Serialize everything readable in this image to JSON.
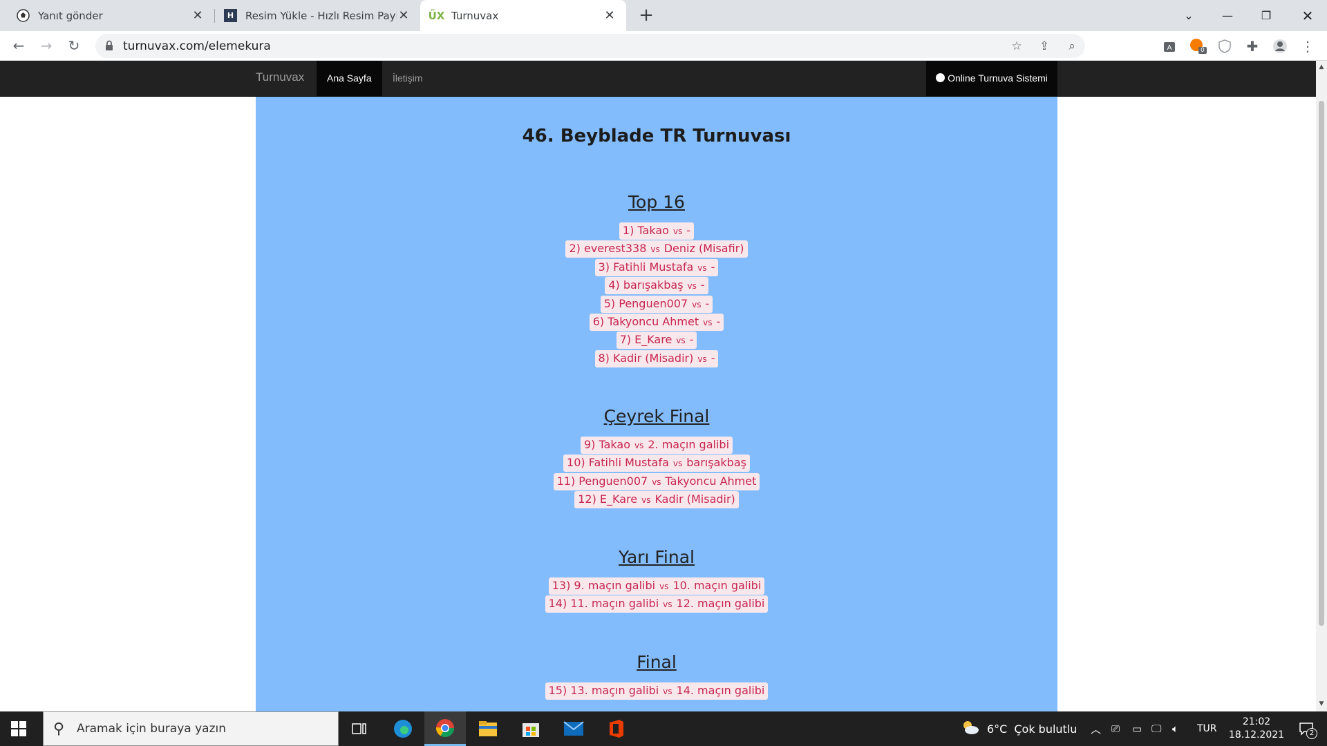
{
  "browser": {
    "tabs": [
      {
        "title": "Yanıt gönder",
        "active": false
      },
      {
        "title": "Resim Yükle - Hızlı Resim Paylaş -",
        "active": false
      },
      {
        "title": "Turnuvax",
        "active": true
      }
    ],
    "url": "turnuvax.com/elemekura",
    "extension_badge": "0"
  },
  "site": {
    "brand": "Turnuvax",
    "nav": [
      {
        "label": "Ana Sayfa",
        "active": true
      },
      {
        "label": "İletişim",
        "active": false
      }
    ],
    "right_nav": "Online Turnuva Sistemi",
    "panel_color": "#82bcfc"
  },
  "tournament": {
    "title": "46. Beyblade TR Turnuvası",
    "vs_label": "vs",
    "rounds": [
      {
        "name": "Top 16",
        "matches": [
          {
            "left": "1) Takao",
            "right": "-"
          },
          {
            "left": "2) everest338",
            "right": "Deniz (Misafir)"
          },
          {
            "left": "3) Fatihli Mustafa",
            "right": "-"
          },
          {
            "left": "4) barışakbaş",
            "right": "-"
          },
          {
            "left": "5) Penguen007",
            "right": "-"
          },
          {
            "left": "6) Takyoncu Ahmet",
            "right": "-"
          },
          {
            "left": "7) E_Kare",
            "right": "-"
          },
          {
            "left": "8) Kadir (Misadir)",
            "right": "-"
          }
        ]
      },
      {
        "name": "Çeyrek Final",
        "matches": [
          {
            "left": "9) Takao",
            "right": "2. maçın galibi"
          },
          {
            "left": "10) Fatihli Mustafa",
            "right": "barışakbaş"
          },
          {
            "left": "11) Penguen007",
            "right": "Takyoncu Ahmet"
          },
          {
            "left": "12) E_Kare",
            "right": "Kadir (Misadir)"
          }
        ]
      },
      {
        "name": "Yarı Final",
        "matches": [
          {
            "left": "13) 9. maçın galibi",
            "right": "10. maçın galibi"
          },
          {
            "left": "14) 11. maçın galibi",
            "right": "12. maçın galibi"
          }
        ]
      },
      {
        "name": "Final",
        "matches": [
          {
            "left": "15) 13. maçın galibi",
            "right": "14. maçın galibi"
          }
        ]
      }
    ]
  },
  "taskbar": {
    "search_placeholder": "Aramak için buraya yazın",
    "weather_temp": "6°C",
    "weather_desc": "Çok bulutlu",
    "language": "TUR",
    "time": "21:02",
    "date": "18.12.2021",
    "notification_count": "2"
  }
}
